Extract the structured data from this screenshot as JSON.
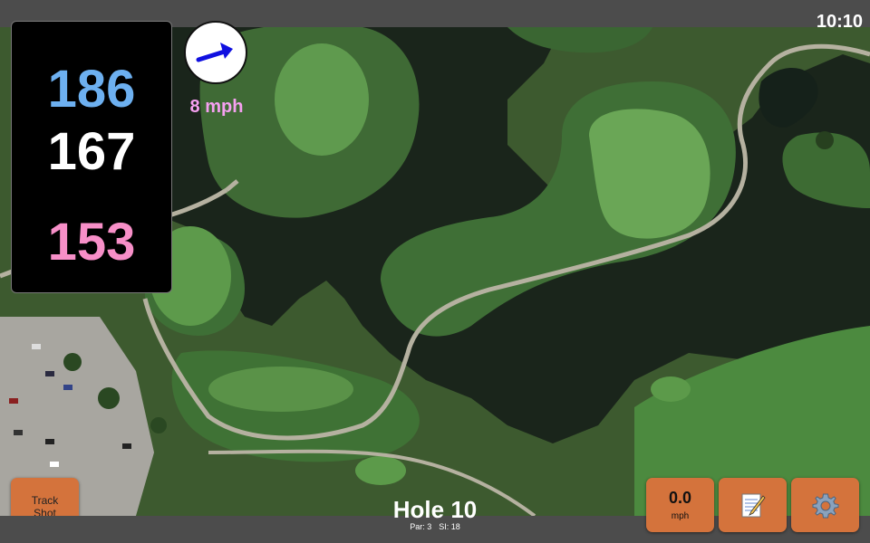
{
  "status_bar": {
    "time": "10:10"
  },
  "distances": {
    "back": "186",
    "middle": "167",
    "front": "153",
    "colors": {
      "back": "#6db0f0",
      "middle": "#ffffff",
      "front": "#f78fc8"
    }
  },
  "wind": {
    "speed_label": "8 mph",
    "direction_icon": "arrow-icon",
    "color": "#1010e0",
    "label_color": "#f5a0f0"
  },
  "hole": {
    "title": "Hole 10",
    "par_label": "Par: 3",
    "si_label": "SI: 18"
  },
  "buttons": {
    "track_shot_line1": "Track",
    "track_shot_line2": "Shot",
    "speed_value": "0.0",
    "speed_unit": "mph",
    "notes_icon": "notepad-icon",
    "settings_icon": "gear-icon",
    "button_color": "#d4733c"
  },
  "colors": {
    "water": "#1d2a1f",
    "fairway": "#4f8a42",
    "green": "#6aa855",
    "path": "#b8b4a4"
  }
}
